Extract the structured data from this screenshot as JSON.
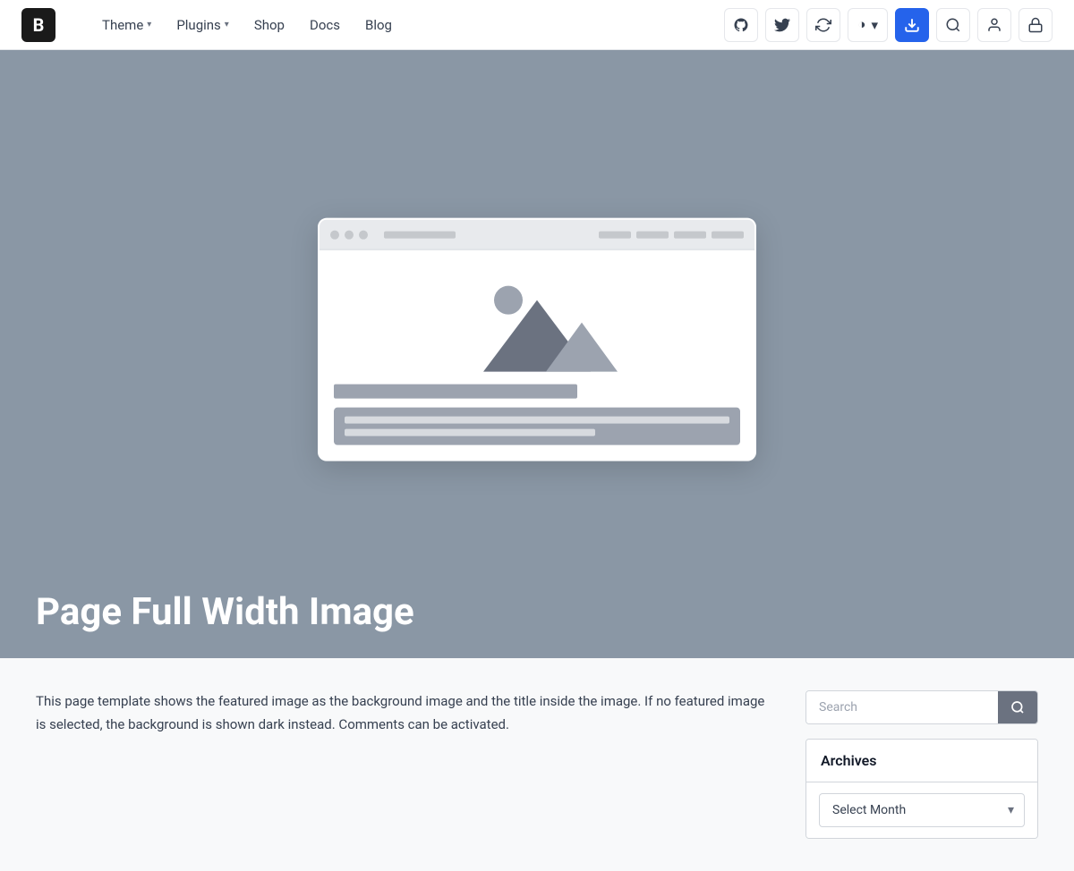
{
  "header": {
    "logo_text": "B",
    "nav_items": [
      {
        "label": "Theme",
        "has_dropdown": true
      },
      {
        "label": "Plugins",
        "has_dropdown": true
      },
      {
        "label": "Shop",
        "has_dropdown": false
      },
      {
        "label": "Docs",
        "has_dropdown": false
      },
      {
        "label": "Blog",
        "has_dropdown": false
      }
    ],
    "icon_buttons": [
      {
        "name": "github-icon",
        "symbol": "⊙",
        "label": "GitHub"
      },
      {
        "name": "twitter-icon",
        "symbol": "🐦",
        "label": "Twitter"
      },
      {
        "name": "refresh-icon",
        "symbol": "↻",
        "label": "Refresh"
      },
      {
        "name": "theme-toggle-btn",
        "symbol": "◑",
        "label": "Theme toggle",
        "has_dropdown": true
      },
      {
        "name": "download-btn",
        "symbol": "⬇",
        "label": "Download",
        "accent": true
      },
      {
        "name": "search-header-btn",
        "symbol": "⌕",
        "label": "Search"
      },
      {
        "name": "user-btn",
        "symbol": "👤",
        "label": "User"
      },
      {
        "name": "lock-btn",
        "symbol": "🔒",
        "label": "Lock"
      }
    ]
  },
  "hero": {
    "title": "Page Full Width Image",
    "bg_color": "#8a97a5"
  },
  "main": {
    "body_text": "This page template shows the featured image as the background image and the title inside the image. If no featured image is selected, the background is shown dark instead. Comments can be activated."
  },
  "sidebar": {
    "search": {
      "placeholder": "Search",
      "button_label": "Search"
    },
    "archives": {
      "title": "Archives",
      "select_label": "Select Month",
      "options": [
        "Select Month"
      ]
    }
  }
}
